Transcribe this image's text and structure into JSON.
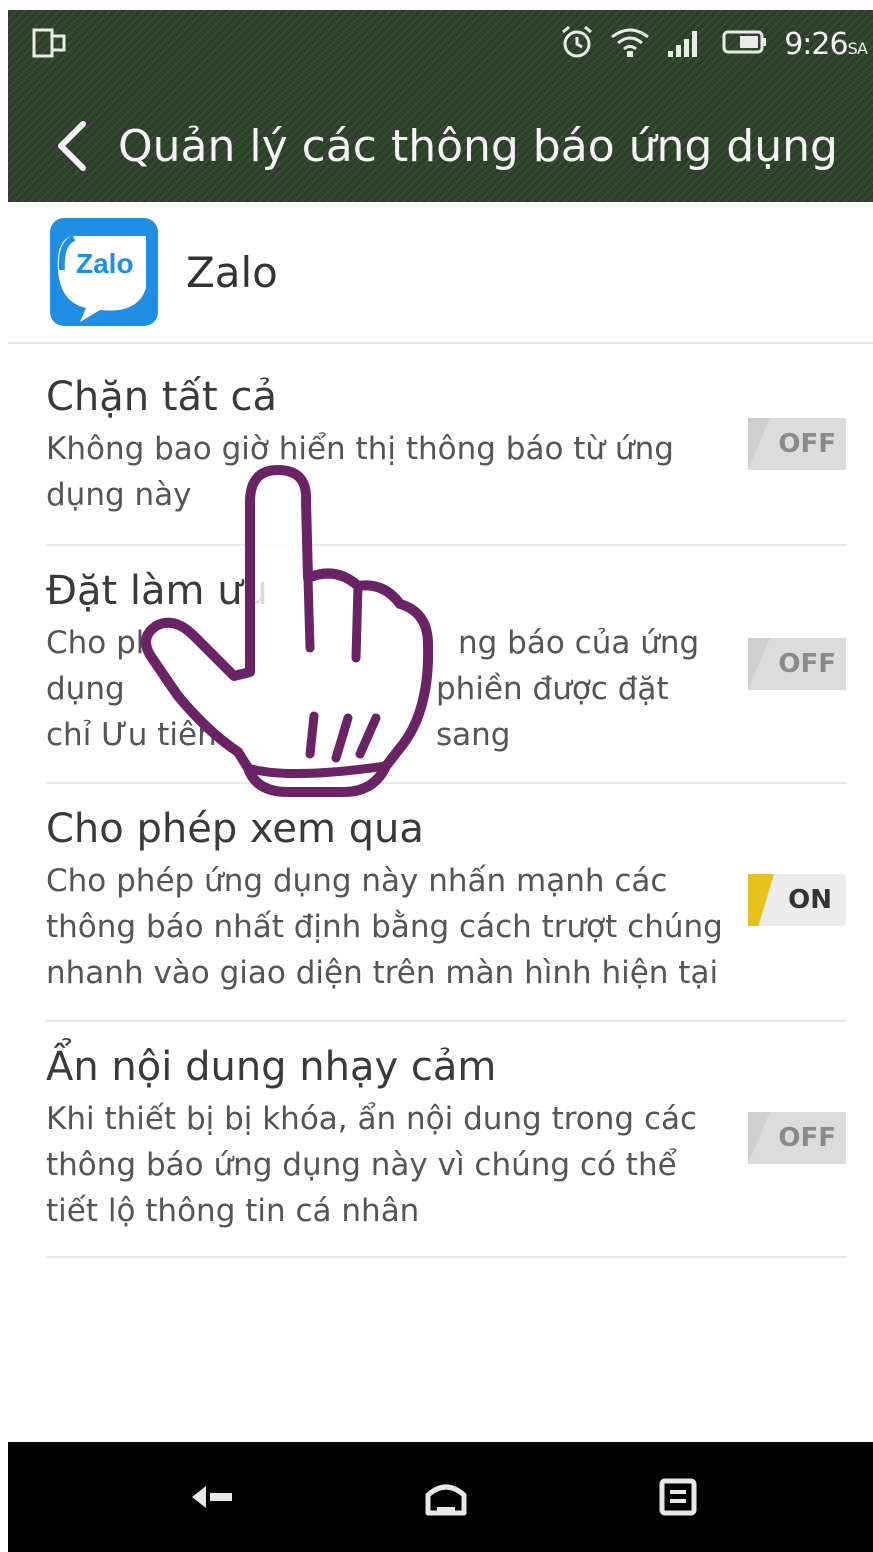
{
  "status_bar": {
    "time": "9:26",
    "time_suffix": "SA",
    "icons": [
      "screen-mirror-icon",
      "alarm-icon",
      "wifi-icon",
      "signal-icon",
      "battery-icon"
    ]
  },
  "toolbar": {
    "back_icon": "chevron-left-icon",
    "title": "Quản lý các thông báo ứng dụng"
  },
  "app": {
    "icon_text": "Zalo",
    "name": "Zalo",
    "icon_color": "#1f8fe6"
  },
  "settings": [
    {
      "title": "Chặn tất cả",
      "description": "Không bao giờ hiển thị thông báo từ ứng dụng này",
      "toggle_label": "OFF",
      "state": "off"
    },
    {
      "title": "Đặt làm ưu",
      "description_lines": [
        "Cho ph",
        "ng báo của ứng",
        "dụng",
        "phiền được đặt sang",
        "chỉ Ưu tiên"
      ],
      "toggle_label": "OFF",
      "state": "off"
    },
    {
      "title": "Cho phép xem qua",
      "description": "Cho phép ứng dụng này nhấn mạnh các thông báo nhất định bằng cách trượt chúng nhanh vào giao diện trên màn hình hiện tại",
      "toggle_label": "ON",
      "state": "on"
    },
    {
      "title": "Ẩn nội dung nhạy cảm",
      "description": "Khi thiết bị bị khóa, ẩn nội dung trong các thông báo ứng dụng này vì chúng có thể tiết lộ thông tin cá nhân",
      "toggle_label": "OFF",
      "state": "off"
    }
  ],
  "colors": {
    "toolbar_bg": "#2d3f2a",
    "toggle_on": "#e8c21c",
    "hand_outline": "#6a2466"
  },
  "navbar": {
    "icons": [
      "nav-back-icon",
      "nav-home-icon",
      "nav-recents-icon"
    ]
  }
}
